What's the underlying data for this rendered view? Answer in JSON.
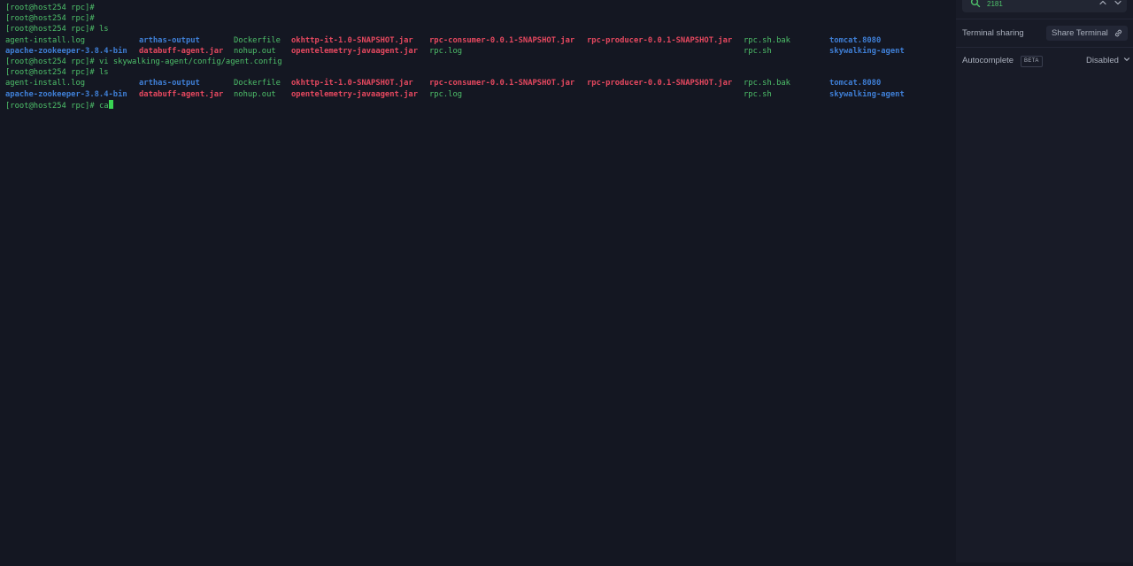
{
  "terminal": {
    "prompt": "[root@host254 rpc]#",
    "lines": [
      {
        "type": "prompt",
        "command": ""
      },
      {
        "type": "prompt",
        "command": ""
      },
      {
        "type": "prompt",
        "command": "ls"
      },
      {
        "type": "listing",
        "cells": [
          {
            "text": "agent-install.log",
            "kind": "plain"
          },
          {
            "text": "arthas-output",
            "kind": "dir"
          },
          {
            "text": "Dockerfile",
            "kind": "plain"
          },
          {
            "text": "okhttp-it-1.0-SNAPSHOT.jar",
            "kind": "jar"
          },
          {
            "text": "rpc-consumer-0.0.1-SNAPSHOT.jar",
            "kind": "jar"
          },
          {
            "text": "rpc-producer-0.0.1-SNAPSHOT.jar",
            "kind": "jar"
          },
          {
            "text": "rpc.sh.bak",
            "kind": "plain"
          },
          {
            "text": "tomcat.8080",
            "kind": "dir"
          }
        ]
      },
      {
        "type": "listing",
        "cells": [
          {
            "text": "apache-zookeeper-3.8.4-bin",
            "kind": "dir"
          },
          {
            "text": "databuff-agent.jar",
            "kind": "jar"
          },
          {
            "text": "nohup.out",
            "kind": "plain"
          },
          {
            "text": "opentelemetry-javaagent.jar",
            "kind": "jar"
          },
          {
            "text": "rpc.log",
            "kind": "plain"
          },
          {
            "text": "",
            "kind": "plain"
          },
          {
            "text": "rpc.sh",
            "kind": "plain"
          },
          {
            "text": "skywalking-agent",
            "kind": "dir"
          }
        ]
      },
      {
        "type": "prompt",
        "command": "vi skywalking-agent/config/agent.config"
      },
      {
        "type": "prompt",
        "command": "ls"
      },
      {
        "type": "listing",
        "cells": [
          {
            "text": "agent-install.log",
            "kind": "plain"
          },
          {
            "text": "arthas-output",
            "kind": "dir"
          },
          {
            "text": "Dockerfile",
            "kind": "plain"
          },
          {
            "text": "okhttp-it-1.0-SNAPSHOT.jar",
            "kind": "jar"
          },
          {
            "text": "rpc-consumer-0.0.1-SNAPSHOT.jar",
            "kind": "jar"
          },
          {
            "text": "rpc-producer-0.0.1-SNAPSHOT.jar",
            "kind": "jar"
          },
          {
            "text": "rpc.sh.bak",
            "kind": "plain"
          },
          {
            "text": "tomcat.8080",
            "kind": "dir"
          }
        ]
      },
      {
        "type": "listing",
        "cells": [
          {
            "text": "apache-zookeeper-3.8.4-bin",
            "kind": "dir"
          },
          {
            "text": "databuff-agent.jar",
            "kind": "jar"
          },
          {
            "text": "nohup.out",
            "kind": "plain"
          },
          {
            "text": "opentelemetry-javaagent.jar",
            "kind": "jar"
          },
          {
            "text": "rpc.log",
            "kind": "plain"
          },
          {
            "text": "",
            "kind": "plain"
          },
          {
            "text": "rpc.sh",
            "kind": "plain"
          },
          {
            "text": "skywalking-agent",
            "kind": "dir"
          }
        ]
      },
      {
        "type": "prompt",
        "command": "ca",
        "cursor": true
      }
    ]
  },
  "search": {
    "value": "2181",
    "icon": "search-icon",
    "prev_icon": "chevron-up-icon",
    "next_icon": "chevron-down-icon"
  },
  "sharing": {
    "label": "Terminal sharing",
    "button_label": "Share Terminal",
    "button_icon": "link-icon"
  },
  "autocomplete": {
    "label": "Autocomplete",
    "badge": "BETA",
    "value": "Disabled",
    "icon": "chevron-down-icon"
  },
  "colors": {
    "background": "#141722",
    "panel": "#181b27",
    "plain": "#4ec06a",
    "directory": "#3f7fd6",
    "jar": "#e5485f",
    "cursor": "#39d353"
  }
}
